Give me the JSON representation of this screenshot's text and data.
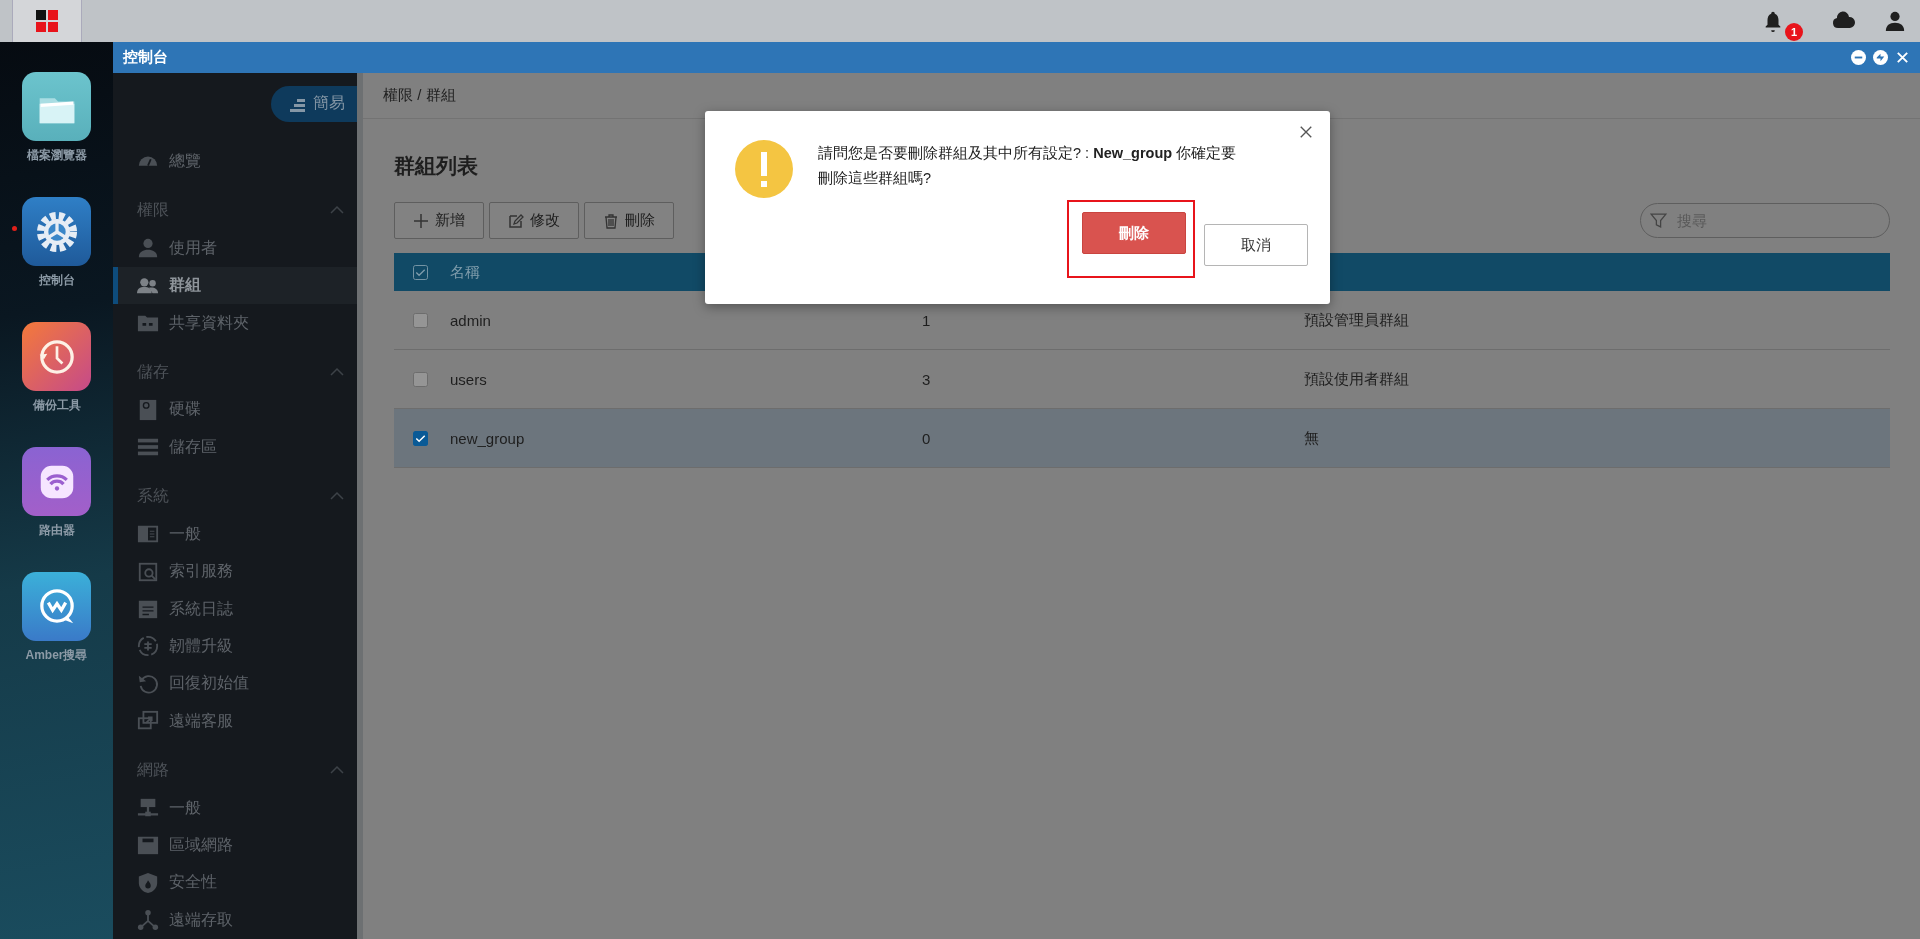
{
  "topbar": {
    "notification_count": "1"
  },
  "dock": [
    {
      "label": "檔案瀏覽器",
      "running": false
    },
    {
      "label": "控制台",
      "running": true
    },
    {
      "label": "備份工具",
      "running": false
    },
    {
      "label": "路由器",
      "running": false
    },
    {
      "label": "Amber搜尋",
      "running": false
    }
  ],
  "window": {
    "title": "控制台"
  },
  "sidebar": {
    "mode_button": "簡易",
    "overview": {
      "label": "總覽",
      "selected": false
    },
    "sections": [
      {
        "title": "權限",
        "expanded": true,
        "items": [
          {
            "label": "使用者",
            "selected": false
          },
          {
            "label": "群組",
            "selected": true
          },
          {
            "label": "共享資料夾",
            "selected": false
          }
        ]
      },
      {
        "title": "儲存",
        "expanded": true,
        "items": [
          {
            "label": "硬碟",
            "selected": false
          },
          {
            "label": "儲存區",
            "selected": false
          }
        ]
      },
      {
        "title": "系統",
        "expanded": true,
        "items": [
          {
            "label": "一般",
            "selected": false
          },
          {
            "label": "索引服務",
            "selected": false
          },
          {
            "label": "系統日誌",
            "selected": false
          },
          {
            "label": "韌體升級",
            "selected": false
          },
          {
            "label": "回復初始值",
            "selected": false
          },
          {
            "label": "遠端客服",
            "selected": false
          }
        ]
      },
      {
        "title": "網路",
        "expanded": true,
        "items": [
          {
            "label": "一般",
            "selected": false
          },
          {
            "label": "區域網路",
            "selected": false
          },
          {
            "label": "安全性",
            "selected": false
          },
          {
            "label": "遠端存取",
            "selected": false
          }
        ]
      }
    ]
  },
  "breadcrumb": "權限 / 群組",
  "page_title": "群組列表",
  "toolbar": [
    "新增",
    "修改",
    "刪除"
  ],
  "search": {
    "placeholder": "搜尋"
  },
  "table": {
    "columns": [
      "名稱"
    ],
    "all_checked": true,
    "rows": [
      {
        "cells": [
          "admin",
          "1",
          "預設管理員群組"
        ],
        "checked": false
      },
      {
        "cells": [
          "users",
          "3",
          "預設使用者群組"
        ],
        "checked": false
      },
      {
        "cells": [
          "new_group",
          "0",
          "無"
        ],
        "checked": true
      }
    ]
  },
  "dialog": {
    "message": "請問您是否要刪除群組及其中所有設定? : **New_group** 你確定要刪除這些群組嗎?",
    "buttons": [
      {
        "label": "刪除",
        "kind": "primary",
        "highlighted": true
      },
      {
        "label": "取消",
        "kind": "default",
        "highlighted": false
      }
    ]
  }
}
